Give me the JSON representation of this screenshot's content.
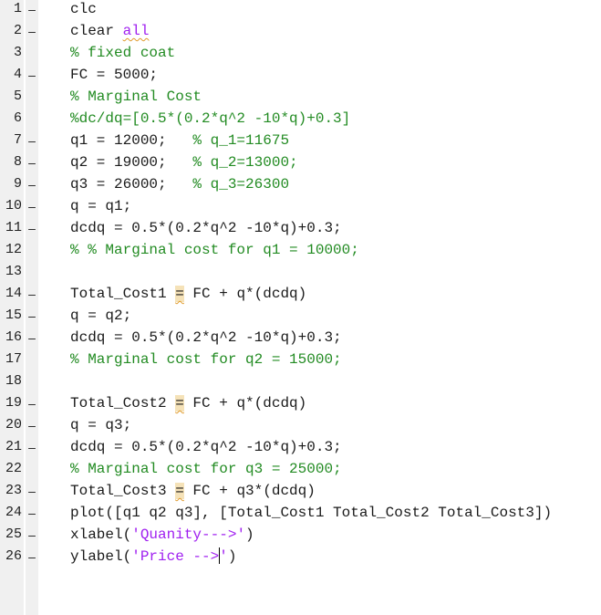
{
  "editor": {
    "language": "MATLAB",
    "lines": [
      {
        "n": "1",
        "marker": "–",
        "code": [
          {
            "t": "clc",
            "k": "code"
          }
        ]
      },
      {
        "n": "2",
        "marker": "–",
        "code": [
          {
            "t": "clear ",
            "k": "code"
          },
          {
            "t": "all",
            "k": "keyword-arg"
          }
        ]
      },
      {
        "n": "3",
        "marker": "",
        "code": [
          {
            "t": "% fixed coat",
            "k": "comment"
          }
        ]
      },
      {
        "n": "4",
        "marker": "–",
        "code": [
          {
            "t": "FC = 5000;",
            "k": "code"
          }
        ]
      },
      {
        "n": "5",
        "marker": "",
        "code": [
          {
            "t": "% Marginal Cost",
            "k": "comment"
          }
        ]
      },
      {
        "n": "6",
        "marker": "",
        "code": [
          {
            "t": "%dc/dq=[0.5*(0.2*q^2 -10*q)+0.3]",
            "k": "comment"
          }
        ]
      },
      {
        "n": "7",
        "marker": "–",
        "code": [
          {
            "t": "q1 = 12000;   ",
            "k": "code"
          },
          {
            "t": "% q_1=11675",
            "k": "comment"
          }
        ]
      },
      {
        "n": "8",
        "marker": "–",
        "code": [
          {
            "t": "q2 = 19000;   ",
            "k": "code"
          },
          {
            "t": "% q_2=13000;",
            "k": "comment"
          }
        ]
      },
      {
        "n": "9",
        "marker": "–",
        "code": [
          {
            "t": "q3 = 26000;   ",
            "k": "code"
          },
          {
            "t": "% q_3=26300",
            "k": "comment"
          }
        ]
      },
      {
        "n": "10",
        "marker": "–",
        "code": [
          {
            "t": "q = q1;",
            "k": "code"
          }
        ]
      },
      {
        "n": "11",
        "marker": "–",
        "code": [
          {
            "t": "dcdq = 0.5*(0.2*q^2 -10*q)+0.3;",
            "k": "code"
          }
        ]
      },
      {
        "n": "12",
        "marker": "",
        "code": [
          {
            "t": "% % Marginal cost for q1 = 10000;",
            "k": "comment"
          }
        ]
      },
      {
        "n": "13",
        "marker": "",
        "code": []
      },
      {
        "n": "14",
        "marker": "–",
        "code": [
          {
            "t": "Total_Cost1 ",
            "k": "code"
          },
          {
            "t": "=",
            "k": "warn"
          },
          {
            "t": " FC + q*(dcdq)",
            "k": "code"
          }
        ]
      },
      {
        "n": "15",
        "marker": "–",
        "code": [
          {
            "t": "q = q2;",
            "k": "code"
          }
        ]
      },
      {
        "n": "16",
        "marker": "–",
        "code": [
          {
            "t": "dcdq = 0.5*(0.2*q^2 -10*q)+0.3;",
            "k": "code"
          }
        ]
      },
      {
        "n": "17",
        "marker": "",
        "code": [
          {
            "t": "% Marginal cost for q2 = 15000;",
            "k": "comment"
          }
        ]
      },
      {
        "n": "18",
        "marker": "",
        "code": []
      },
      {
        "n": "19",
        "marker": "–",
        "code": [
          {
            "t": "Total_Cost2 ",
            "k": "code"
          },
          {
            "t": "=",
            "k": "warn"
          },
          {
            "t": " FC + q*(dcdq)",
            "k": "code"
          }
        ]
      },
      {
        "n": "20",
        "marker": "–",
        "code": [
          {
            "t": "q = q3;",
            "k": "code"
          }
        ]
      },
      {
        "n": "21",
        "marker": "–",
        "code": [
          {
            "t": "dcdq = 0.5*(0.2*q^2 -10*q)+0.3;",
            "k": "code"
          }
        ]
      },
      {
        "n": "22",
        "marker": "",
        "code": [
          {
            "t": "% Marginal cost for q3 = 25000;",
            "k": "comment"
          }
        ]
      },
      {
        "n": "23",
        "marker": "–",
        "code": [
          {
            "t": "Total_Cost3 ",
            "k": "code"
          },
          {
            "t": "=",
            "k": "warn"
          },
          {
            "t": " FC + q3*(dcdq)",
            "k": "code"
          }
        ]
      },
      {
        "n": "24",
        "marker": "–",
        "code": [
          {
            "t": "plot([q1 q2 q3], [Total_Cost1 Total_Cost2 Total_Cost3])",
            "k": "code"
          }
        ]
      },
      {
        "n": "25",
        "marker": "–",
        "code": [
          {
            "t": "xlabel(",
            "k": "code"
          },
          {
            "t": "'Quanity--->'",
            "k": "string"
          },
          {
            "t": ")",
            "k": "code"
          }
        ]
      },
      {
        "n": "26",
        "marker": "–",
        "code": [
          {
            "t": "ylabel(",
            "k": "code"
          },
          {
            "t": "'Price -->",
            "k": "string"
          },
          {
            "t": "",
            "k": "caret"
          },
          {
            "t": "'",
            "k": "string"
          },
          {
            "t": ")",
            "k": "code"
          }
        ]
      }
    ]
  },
  "colors": {
    "code": "#1a1a1a",
    "comment": "#228b22",
    "string": "#a020f0",
    "warning_highlight": "#f5e2b8",
    "warning_squiggle": "#e09a2c",
    "gutter": "#f0f0f0"
  }
}
